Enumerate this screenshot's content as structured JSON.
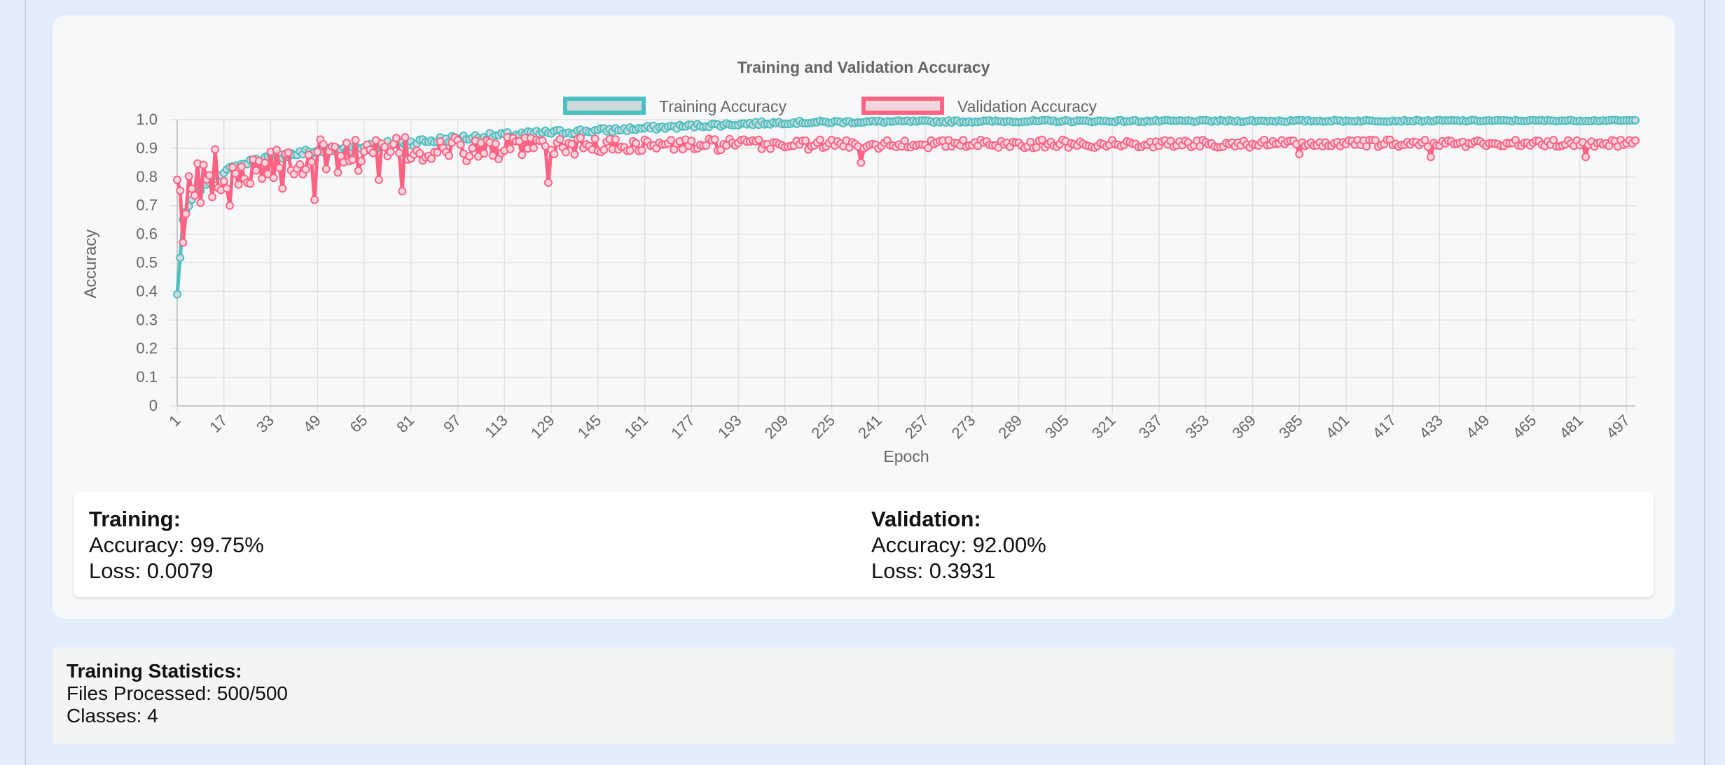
{
  "chart_data": {
    "type": "line",
    "title": "Training and Validation Accuracy",
    "xlabel": "Epoch",
    "ylabel": "Accuracy",
    "x_range": [
      1,
      500
    ],
    "x_ticks": [
      "1",
      "17",
      "33",
      "49",
      "65",
      "81",
      "97",
      "113",
      "129",
      "145",
      "161",
      "177",
      "193",
      "209",
      "225",
      "241",
      "257",
      "273",
      "289",
      "305",
      "321",
      "337",
      "353",
      "369",
      "385",
      "401",
      "417",
      "433",
      "449",
      "465",
      "481",
      "497"
    ],
    "ylim": [
      0,
      1.0
    ],
    "y_ticks": [
      "0",
      "0.1",
      "0.2",
      "0.3",
      "0.4",
      "0.5",
      "0.6",
      "0.7",
      "0.8",
      "0.9",
      "1.0"
    ],
    "grid": true,
    "legend_position": "top-center",
    "series": [
      {
        "name": "Training Accuracy",
        "color": "#4bc0c0",
        "fill": "#cfd8dc",
        "anchors": [
          [
            1,
            0.39
          ],
          [
            3,
            0.65
          ],
          [
            6,
            0.72
          ],
          [
            10,
            0.77
          ],
          [
            17,
            0.82
          ],
          [
            25,
            0.85
          ],
          [
            33,
            0.87
          ],
          [
            49,
            0.89
          ],
          [
            65,
            0.905
          ],
          [
            81,
            0.92
          ],
          [
            97,
            0.935
          ],
          [
            113,
            0.945
          ],
          [
            129,
            0.955
          ],
          [
            145,
            0.962
          ],
          [
            161,
            0.97
          ],
          [
            177,
            0.978
          ],
          [
            193,
            0.985
          ],
          [
            209,
            0.99
          ],
          [
            241,
            0.993
          ],
          [
            305,
            0.995
          ],
          [
            500,
            0.997
          ]
        ],
        "noise": [
          [
            1,
            0.005
          ],
          [
            60,
            0.015
          ],
          [
            150,
            0.008
          ],
          [
            250,
            0.004
          ],
          [
            500,
            0.002
          ]
        ]
      },
      {
        "name": "Validation Accuracy",
        "color": "#ff6384",
        "fill": "#f0d6dd",
        "anchors": [
          [
            1,
            0.79
          ],
          [
            3,
            0.62
          ],
          [
            5,
            0.74
          ],
          [
            10,
            0.82
          ],
          [
            17,
            0.83
          ],
          [
            33,
            0.86
          ],
          [
            49,
            0.87
          ],
          [
            65,
            0.88
          ],
          [
            81,
            0.89
          ],
          [
            97,
            0.895
          ],
          [
            113,
            0.9
          ],
          [
            129,
            0.905
          ],
          [
            145,
            0.91
          ],
          [
            177,
            0.912
          ],
          [
            241,
            0.915
          ],
          [
            500,
            0.918
          ]
        ],
        "noise": [
          [
            1,
            0.08
          ],
          [
            100,
            0.045
          ],
          [
            150,
            0.025
          ],
          [
            250,
            0.015
          ],
          [
            500,
            0.012
          ]
        ],
        "dips": [
          [
            9,
            0.71
          ],
          [
            13,
            0.73
          ],
          [
            19,
            0.7
          ],
          [
            25,
            0.78
          ],
          [
            37,
            0.76
          ],
          [
            48,
            0.72
          ],
          [
            70,
            0.79
          ],
          [
            78,
            0.75
          ],
          [
            128,
            0.78
          ],
          [
            235,
            0.85
          ],
          [
            385,
            0.88
          ],
          [
            430,
            0.87
          ],
          [
            483,
            0.87
          ]
        ]
      }
    ]
  },
  "metrics": {
    "training": {
      "heading": "Training:",
      "accuracy": "Accuracy: 99.75%",
      "loss": "Loss: 0.0079"
    },
    "validation": {
      "heading": "Validation:",
      "accuracy": "Accuracy: 92.00%",
      "loss": "Loss: 0.3931"
    }
  },
  "stats": {
    "heading": "Training Statistics:",
    "files": "Files Processed: 500/500",
    "classes": "Classes: 4"
  }
}
